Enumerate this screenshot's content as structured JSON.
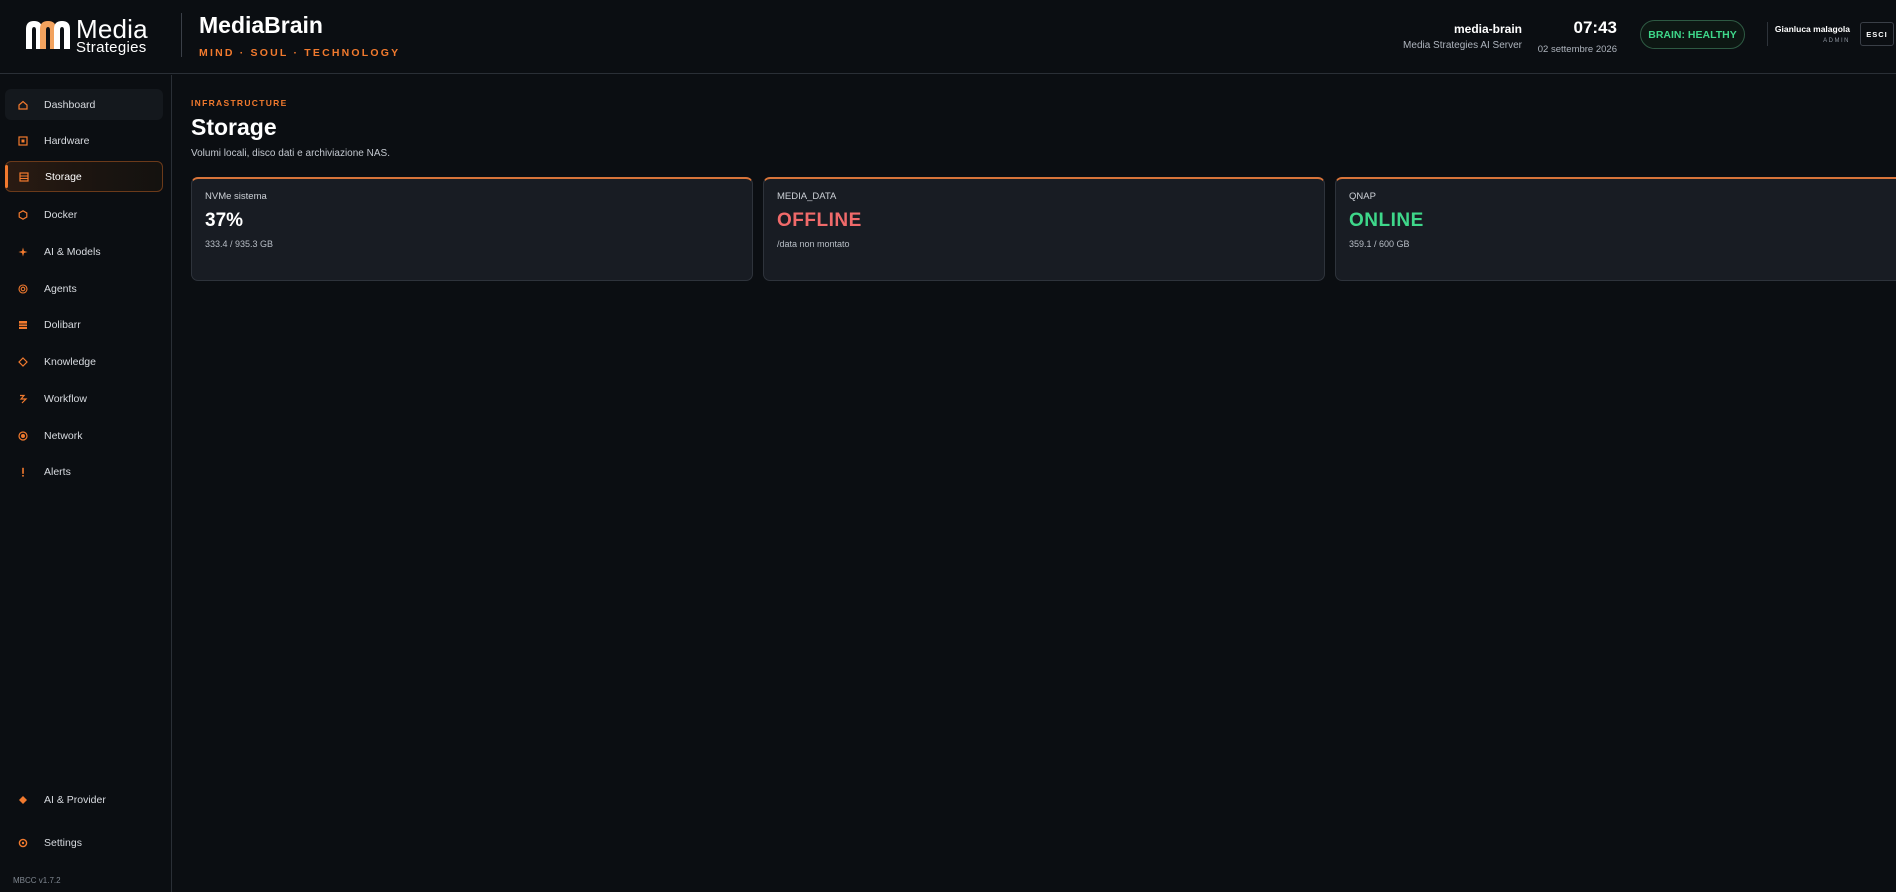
{
  "header": {
    "logo_line1": "Media",
    "logo_line2": "Strategies",
    "brand_title": "MediaBrain",
    "brand_tagline": "MIND · SOUL · TECHNOLOGY",
    "server_name": "media-brain",
    "server_desc": "Media Strategies AI Server",
    "time": "07:43",
    "date": "02 settembre 2026",
    "health_badge": "BRAIN: HEALTHY",
    "user_name": "Gianluca malagola",
    "user_role": "ADMIN",
    "logout_label": "ESCI"
  },
  "sidebar": {
    "items": [
      {
        "label": "Dashboard",
        "icon": "home-icon"
      },
      {
        "label": "Hardware",
        "icon": "chip-icon"
      },
      {
        "label": "Storage",
        "icon": "storage-icon"
      },
      {
        "label": "Docker",
        "icon": "hexagon-icon"
      },
      {
        "label": "AI & Models",
        "icon": "sparkle-icon"
      },
      {
        "label": "Agents",
        "icon": "agent-icon"
      },
      {
        "label": "Dolibarr",
        "icon": "grid-icon"
      },
      {
        "label": "Knowledge",
        "icon": "diamond-icon"
      },
      {
        "label": "Workflow",
        "icon": "workflow-icon"
      },
      {
        "label": "Network",
        "icon": "network-icon"
      },
      {
        "label": "Alerts",
        "icon": "alert-icon"
      }
    ],
    "bottom_items": [
      {
        "label": "AI & Provider",
        "icon": "provider-icon"
      },
      {
        "label": "Settings",
        "icon": "gear-icon"
      }
    ],
    "active": "Storage",
    "version": "MBCC v1.7.2"
  },
  "main": {
    "section_label": "INFRASTRUCTURE",
    "title": "Storage",
    "subtitle": "Volumi locali, disco dati e archiviazione NAS.",
    "cards": [
      {
        "label": "NVMe sistema",
        "value": "37%",
        "detail": "333.4 / 935.3 GB"
      },
      {
        "label": "MEDIA_DATA",
        "value": "OFFLINE",
        "detail": "/data non montato"
      },
      {
        "label": "QNAP",
        "value": "ONLINE",
        "detail": "359.1 / 600 GB"
      }
    ]
  },
  "colors": {
    "accent": "#f27a2e",
    "healthy": "#3ed78a",
    "offline": "#f06a6a",
    "background": "#0b0e12",
    "card": "#181c23"
  }
}
